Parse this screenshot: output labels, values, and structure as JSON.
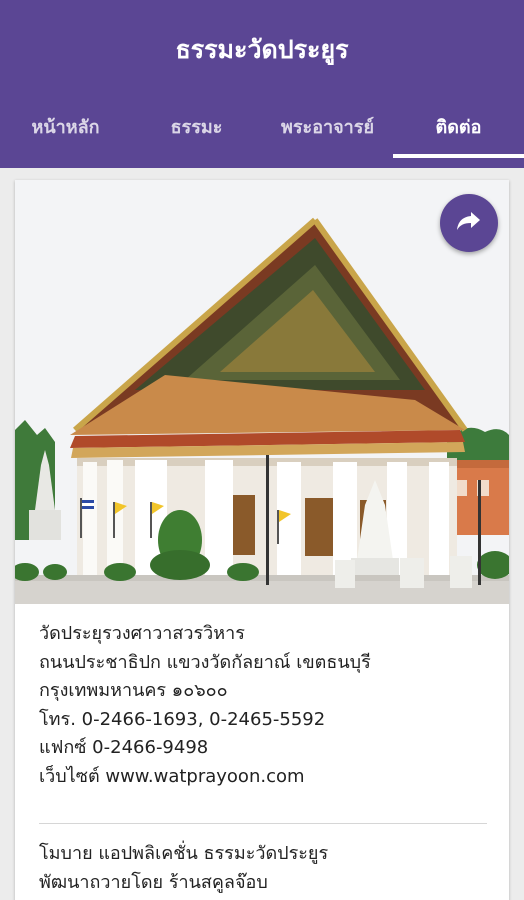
{
  "app": {
    "title": "ธรรมะวัดประยูร"
  },
  "tabs": [
    {
      "label": "หน้าหลัก"
    },
    {
      "label": "ธรรมะ"
    },
    {
      "label": "พระอาจารย์"
    },
    {
      "label": "ติดต่อ"
    }
  ],
  "active_tab": "ติดต่อ",
  "share": {
    "icon": "share-icon"
  },
  "contact": {
    "name": "วัดประยุรวงศาวาสวรวิหาร",
    "address_line1": "ถนนประชาธิปก แขวงวัดกัลยาณ์ เขตธนบุรี",
    "address_line2": "กรุงเทพมหานคร ๑๐๖๐๐",
    "phone": "โทร. 0-2466-1693, 0-2465-5592",
    "fax": "แฟกซ์ 0-2466-9498",
    "website": "เว็บไซต์ www.watprayoon.com"
  },
  "credits": {
    "line1": "โมบาย แอปพลิเคชั่น ธรรมะวัดประยูร",
    "line2": "พัฒนาถวายโดย ร้านสคูลจ๊อบ"
  },
  "colors": {
    "primary": "#5b4694",
    "background": "#ececec",
    "card": "#ffffff"
  }
}
